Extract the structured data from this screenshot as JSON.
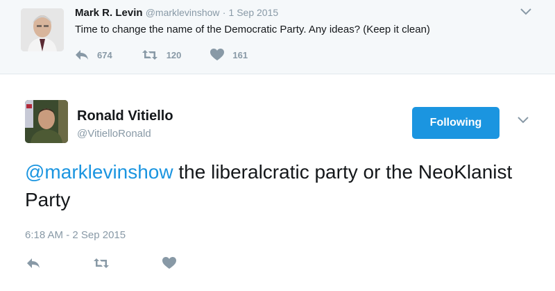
{
  "parent_tweet": {
    "name": "Mark R. Levin",
    "handle": "@marklevinshow",
    "separator": "·",
    "date": "1 Sep 2015",
    "text": "Time to change the name of the Democratic Party. Any ideas?  (Keep it clean)",
    "reply_count": "674",
    "retweet_count": "120",
    "like_count": "161"
  },
  "tweet": {
    "name": "Ronald Vitiello",
    "handle": "@VitielloRonald",
    "follow_label": "Following",
    "mention": "@marklevinshow",
    "text_rest": " the liberalcratic party or the NeoKlanist Party",
    "timestamp": "6:18 AM - 2 Sep 2015"
  },
  "colors": {
    "accent": "#1b95e0",
    "muted": "#8899a6",
    "parent_bg": "#f5f8fa"
  },
  "icons": [
    "reply-icon",
    "retweet-icon",
    "like-icon",
    "chevron-down-icon"
  ]
}
